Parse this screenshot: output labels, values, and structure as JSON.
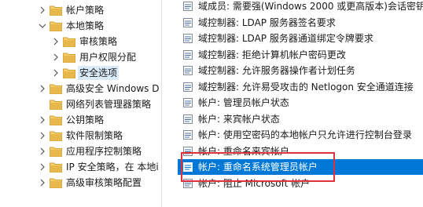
{
  "tree": {
    "items": [
      {
        "label": "帐户策略",
        "indent": 3,
        "chevron": "right",
        "selected": false
      },
      {
        "label": "本地策略",
        "indent": 3,
        "chevron": "down",
        "selected": false
      },
      {
        "label": "审核策略",
        "indent": 4,
        "chevron": "right",
        "selected": false
      },
      {
        "label": "用户权限分配",
        "indent": 4,
        "chevron": "right",
        "selected": false
      },
      {
        "label": "安全选项",
        "indent": 4,
        "chevron": "right",
        "selected": true
      },
      {
        "label": "高级安全 Windows D",
        "indent": 3,
        "chevron": "right",
        "selected": false
      },
      {
        "label": "网络列表管理器策略",
        "indent": 3,
        "chevron": "none",
        "selected": false
      },
      {
        "label": "公钥策略",
        "indent": 3,
        "chevron": "right",
        "selected": false
      },
      {
        "label": "软件限制策略",
        "indent": 3,
        "chevron": "right",
        "selected": false
      },
      {
        "label": "应用程序控制策略",
        "indent": 3,
        "chevron": "right",
        "selected": false
      },
      {
        "label": "IP 安全策略，在 本地i",
        "indent": 3,
        "chevron": "right",
        "selected": false
      },
      {
        "label": "高级审核策略配置",
        "indent": 3,
        "chevron": "right",
        "selected": false
      }
    ]
  },
  "policies": {
    "items": [
      {
        "label": "域成员: 需要强(Windows 2000 或更高版本)会话密钥",
        "selected": false
      },
      {
        "label": "域控制器: LDAP 服务器签名要求",
        "selected": false
      },
      {
        "label": "域控制器: LDAP 服务器通道绑定令牌要求",
        "selected": false
      },
      {
        "label": "域控制器: 拒绝计算机帐户密码更改",
        "selected": false
      },
      {
        "label": "域控制器: 允许服务器操作者计划任务",
        "selected": false
      },
      {
        "label": "域控制器: 允许易受攻击的 Netlogon 安全通道连接",
        "selected": false
      },
      {
        "label": "帐户: 管理员帐户状态",
        "selected": false
      },
      {
        "label": "帐户: 来宾帐户状态",
        "selected": false
      },
      {
        "label": "帐户: 使用空密码的本地帐户只允许进行控制台登录",
        "selected": false
      },
      {
        "label": "帐户: 重命名来宾帐户",
        "selected": false
      },
      {
        "label": "帐户: 重命名系统管理员帐户",
        "selected": true
      },
      {
        "label": "帐户: 阻止 Microsoft 帐户",
        "selected": false
      }
    ]
  },
  "colors": {
    "selection": "#0078d7",
    "tree_selection": "#d9ebf9",
    "highlight_box": "#e0323e",
    "folder": "#e8b84c"
  }
}
